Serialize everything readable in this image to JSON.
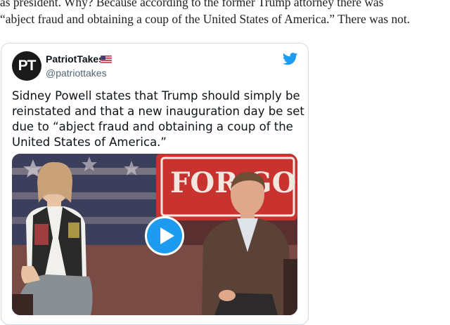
{
  "article": {
    "line1": "as president. Why? Because according to the former Trump attorney there was",
    "line2": "“abject fraud and obtaining a coup of the United States of America.” There was not."
  },
  "tweet": {
    "avatar_initials": "PT",
    "author_name": "PatriotTakes",
    "flag_icon": "us-flag-icon",
    "author_handle": "@patriottakes",
    "platform_icon": "twitter-bird-icon",
    "brand_color": "#1d9bf0",
    "text_lines": [
      "Sidney Powell states that Trump should simply be",
      "reinstated and that a new inauguration day be set",
      "due to “abject fraud and obtaining a coup of the",
      "United States of America.”"
    ],
    "media": {
      "type": "video",
      "play_icon": "play-icon",
      "sign_text": "FOR GOD"
    }
  }
}
